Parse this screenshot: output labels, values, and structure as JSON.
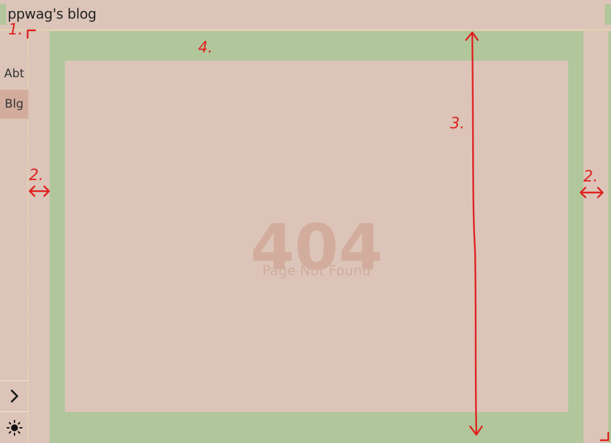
{
  "header": {
    "title": "ppwag's blog"
  },
  "sidebar": {
    "items": [
      {
        "label": "Abt",
        "active": false
      },
      {
        "label": "Blg",
        "active": true
      }
    ],
    "expand_icon": "chevron-right-icon",
    "theme_icon": "sun-icon"
  },
  "main": {
    "error_code": "404",
    "error_message": "Page Not Found"
  },
  "annotations": {
    "labels": [
      "1.",
      "2.",
      "2.",
      "3.",
      "4."
    ]
  },
  "colors": {
    "background": "#dcc5b8",
    "accent_green": "#b2c69b",
    "muted_text": "#d2ad9e",
    "active_nav": "#d2ad9e",
    "annotation": "#e02020"
  }
}
